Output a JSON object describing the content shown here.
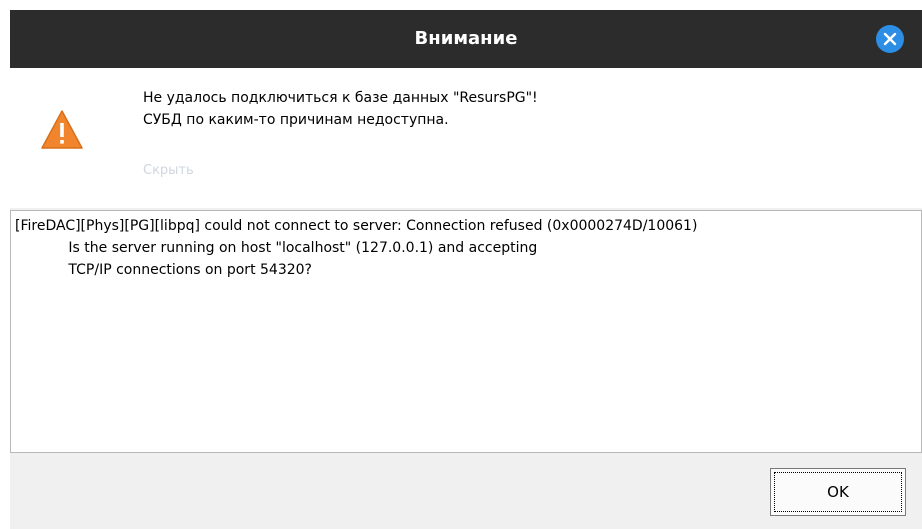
{
  "dialog": {
    "title": "Внимание",
    "close_icon": "close-icon",
    "warning_icon": "warning-icon",
    "message_line1": "Не удалось подключиться к базе данных \"ResursPG\"!",
    "message_line2": "СУБД по каким-то причинам недоступна.",
    "hide_label": "Скрыть",
    "details": "[FireDAC][Phys][PG][libpq] could not connect to server: Connection refused (0x0000274D/10061)\n            Is the server running on host \"localhost\" (127.0.0.1) and accepting\n            TCP/IP connections on port 54320?",
    "ok_label": "OK"
  },
  "colors": {
    "titlebar": "#2c2c2c",
    "close_button": "#2d8ee6",
    "warning_fill": "#f0852d",
    "hide_link": "#cfd6df"
  }
}
